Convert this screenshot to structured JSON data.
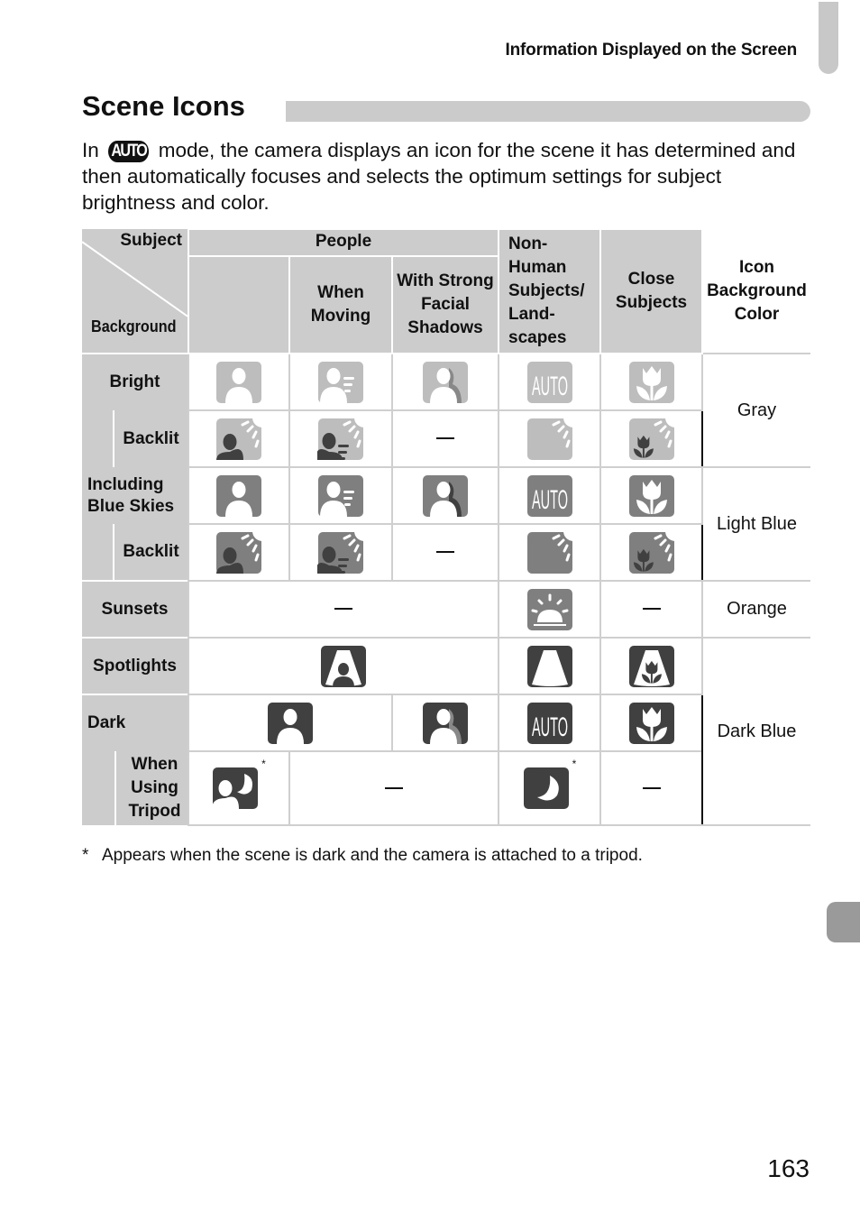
{
  "running_head": "Information Displayed on the Screen",
  "section_title": "Scene Icons",
  "intro": {
    "before_badge": "In ",
    "badge": "AUTO",
    "after_badge": " mode, the camera displays an icon for the scene it has determined and then automatically focuses and selects the optimum settings for subject brightness and color."
  },
  "table": {
    "corner": {
      "subject": "Subject",
      "background": "Background"
    },
    "headers": {
      "people": "People",
      "when_moving": "When Moving",
      "strong_shadows": "With Strong Facial Shadows",
      "non_human": "Non-Human Subjects/ Land-scapes",
      "close_subjects": "Close Subjects",
      "icon_bg_color": "Icon Background Color"
    },
    "rows": {
      "bright": "Bright",
      "bright_backlit": "Backlit",
      "blue_skies": "Including Blue Skies",
      "blue_backlit": "Backlit",
      "sunsets": "Sunsets",
      "spotlights": "Spotlights",
      "dark": "Dark",
      "tripod": "When Using Tripod"
    },
    "colors": {
      "gray": "Gray",
      "light_blue": "Light Blue",
      "orange": "Orange",
      "dark_blue": "Dark Blue"
    },
    "icon_tones": {
      "gray": "#bdbdbd",
      "light_blue": "#7f7f7f",
      "orange": "#7f7f7f",
      "dark": "#404040"
    },
    "auto_text": "AUTO",
    "asterisk": "*"
  },
  "footnote": {
    "mark": "*",
    "text": "Appears when the scene is dark and the camera is attached to a tripod."
  },
  "page_number": "163"
}
